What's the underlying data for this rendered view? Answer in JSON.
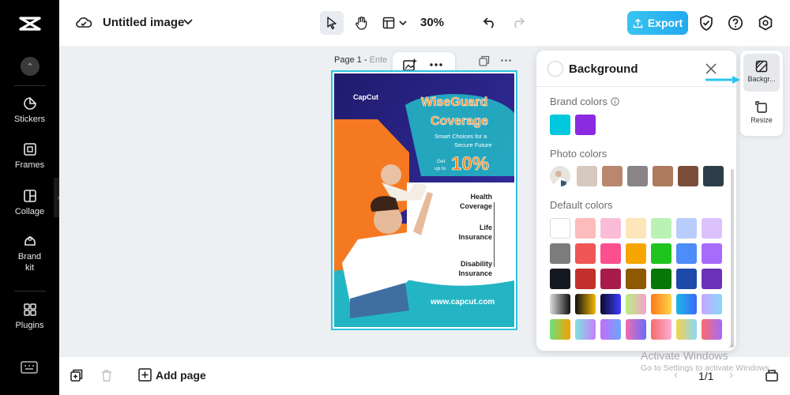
{
  "app": {
    "document_title": "Untitled image",
    "zoom_level": "30%",
    "export_label": "Export"
  },
  "sidebar": {
    "items": [
      {
        "label": "Stickers",
        "icon": "sticker-icon"
      },
      {
        "label": "Frames",
        "icon": "frame-icon"
      },
      {
        "label": "Collage",
        "icon": "collage-icon"
      },
      {
        "label": "Brand kit",
        "icon": "brand-kit-icon"
      },
      {
        "label": "Plugins",
        "icon": "plugins-icon"
      }
    ]
  },
  "canvas": {
    "page_label": "Page 1 -",
    "page_name_placeholder": "Ente"
  },
  "poster": {
    "brand": "CapCut",
    "headline_1": "WiseGuard",
    "headline_2": "Coverage",
    "tagline_1": "Smart Choices for a",
    "tagline_2": "Secure Future",
    "offer_pre_1": "Get",
    "offer_pre_2": "up to",
    "offer_value": "10%",
    "list": [
      {
        "line1": "Health",
        "line2": "Coverage"
      },
      {
        "line1": "Life",
        "line2": "Insurance"
      },
      {
        "line1": "Disability",
        "line2": "Insurance"
      }
    ],
    "url": "www.capcut.com",
    "colors": {
      "navy": "#2c2a8c",
      "orange": "#f57921",
      "teal": "#24b5c4"
    }
  },
  "panel": {
    "title": "Background",
    "brand_colors_label": "Brand colors",
    "brand_colors": [
      "#00c8dc",
      "#8a2be2"
    ],
    "photo_colors_label": "Photo colors",
    "photo_colors": [
      "#d7c8c0",
      "#b98670",
      "#8a8388",
      "#ad7a5e",
      "#7a4e3b",
      "#2e3e48"
    ],
    "default_colors_label": "Default colors",
    "default_colors": [
      [
        "#ffffff",
        "#fdbcbc",
        "#fbbcd8",
        "#fde6b9",
        "#b9f2b4",
        "#b8cdfc",
        "#dcc2fc"
      ],
      [
        "#7c7c7c",
        "#ef5656",
        "#fb4f8e",
        "#f7a600",
        "#1fc41f",
        "#4c8dfa",
        "#a66cfc"
      ],
      [
        "#141820",
        "#c2302c",
        "#a81c4c",
        "#8e5a00",
        "#07770a",
        "#1d4aa8",
        "#6a33b7"
      ]
    ],
    "gradient_rows": [
      [
        [
          "#dcdcdc",
          "#111111"
        ],
        [
          "#111111",
          "#f2b705"
        ],
        [
          "#0b0c2a",
          "#3d3dfc"
        ],
        [
          "#b6f07a",
          "#f5a2d0"
        ],
        [
          "#ff7a1a",
          "#ffd24a"
        ],
        [
          "#1bb5e8",
          "#3b6bfb"
        ],
        [
          "#c8a8fc",
          "#8ad6fb"
        ]
      ],
      [
        [
          "#6fe07a",
          "#f5a000"
        ],
        [
          "#7fe4e0",
          "#c97dfc"
        ],
        [
          "#c56bfc",
          "#6aa8fc"
        ],
        [
          "#f06eb0",
          "#6a6bfc"
        ],
        [
          "#f56b6b",
          "#fbb0d4"
        ],
        [
          "#f5d34a",
          "#8ad6fb"
        ],
        [
          "#fb6b6b",
          "#a56bfc"
        ]
      ]
    ]
  },
  "mini_panel": {
    "background_label": "Backgr...",
    "resize_label": "Resize"
  },
  "bottombar": {
    "add_page_label": "Add page",
    "page_counter": "1/1"
  },
  "watermark": {
    "title": "Activate Windows",
    "subtitle": "Go to Settings to activate Windows."
  }
}
